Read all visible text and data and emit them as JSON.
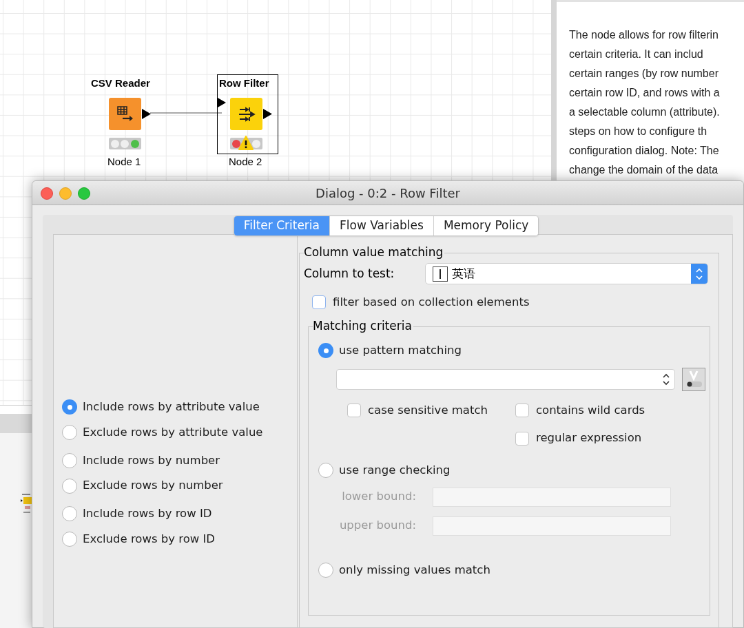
{
  "workflow": {
    "nodes": [
      {
        "title": "CSV Reader",
        "label": "Node 1",
        "kind": "reader",
        "selected": false,
        "executed": true,
        "warning": false
      },
      {
        "title": "Row Filter",
        "label": "Node 2",
        "kind": "filter",
        "selected": true,
        "executed": false,
        "warning": true
      }
    ]
  },
  "description": {
    "lines": [
      "The node allows for row filterin",
      "certain criteria. It can includ",
      "certain ranges (by row number",
      "certain row ID, and rows with a",
      "a selectable column (attribute).",
      "steps on how to configure th",
      "configuration dialog. Note: The",
      "change the domain of the data"
    ]
  },
  "dialog": {
    "title": "Dialog - 0:2 - Row Filter",
    "tabs": [
      {
        "label": "Filter Criteria",
        "selected": true
      },
      {
        "label": "Flow Variables",
        "selected": false
      },
      {
        "label": "Memory Policy",
        "selected": false
      }
    ],
    "filter_modes": [
      {
        "label": "Include rows by attribute value",
        "selected": true
      },
      {
        "label": "Exclude rows by attribute value",
        "selected": false
      },
      {
        "label": "Include rows by number",
        "selected": false
      },
      {
        "label": "Exclude rows by number",
        "selected": false
      },
      {
        "label": "Include rows by row ID",
        "selected": false
      },
      {
        "label": "Exclude rows by row ID",
        "selected": false
      }
    ],
    "column_value_matching": {
      "title": "Column value matching",
      "column_label": "Column to test:",
      "column_value": "英语",
      "collection_filter": {
        "label": "filter based on collection elements",
        "checked": false
      },
      "matching_criteria": {
        "title": "Matching criteria",
        "options": [
          {
            "kind": "pattern",
            "label": "use pattern matching",
            "selected": true
          },
          {
            "kind": "range",
            "label": "use range checking",
            "selected": false
          },
          {
            "kind": "missing",
            "label": "only missing values match",
            "selected": false
          }
        ],
        "pattern_checks": [
          {
            "label": "case sensitive match",
            "checked": false
          },
          {
            "label": "contains wild cards",
            "checked": false
          },
          {
            "label": "regular expression",
            "checked": false
          }
        ],
        "range_fields": [
          {
            "label": "lower bound:",
            "disabled": true
          },
          {
            "label": "upper bound:",
            "disabled": true
          }
        ]
      }
    }
  }
}
